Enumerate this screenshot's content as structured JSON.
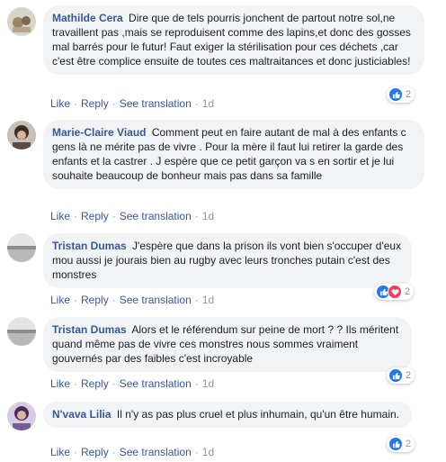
{
  "comments": [
    {
      "author": "Mathilde Cera",
      "text": "Dire que de tels pourris jonchent de partout notre sol,ne travaillent pas ,mais se reproduisent comme des lapins,et donc des gosses mal barrés pour le futur! Faut exiger la stérilisation pour ces déchets ,car c'est être complice ensuite de toutes ces maltraitances et donc justiciables!",
      "like": "Like",
      "reply": "Reply",
      "translate": "See translation",
      "time": "1d",
      "reactions": [
        "like"
      ],
      "reaction_count": "2"
    },
    {
      "author": "Marie-Claire Viaud",
      "text": "Comment peut en faire autant de mal à des enfants c gens là ne mérite pas de vivre . Pour la mère il faut lui retirer la garde des enfants et la castrer . J espère que ce petit garçon va s en sortir et je lui souhaite beaucoup de bonheur mais pas dans sa famille",
      "like": "Like",
      "reply": "Reply",
      "translate": "See translation",
      "time": "1d",
      "reactions": [],
      "reaction_count": ""
    },
    {
      "author": "Tristan Dumas",
      "text": "J'espère que dans la prison ils vont bien s'occuper d'eux mou aussi je jourais bien au rugby avec leurs tronches putain c'est des monstres",
      "like": "Like",
      "reply": "Reply",
      "translate": "See translation",
      "time": "1d",
      "reactions": [
        "like",
        "love"
      ],
      "reaction_count": "2"
    },
    {
      "author": "Tristan Dumas",
      "text": "Alors et le référendum sur peine de mort ? ? Ils méritent quand même pas de vivre ces monstres nous sommes vraiment gouvernés par des faibles c'est incroyable",
      "like": "Like",
      "reply": "Reply",
      "translate": "See translation",
      "time": "1d",
      "reactions": [
        "like"
      ],
      "reaction_count": "2"
    },
    {
      "author": "N'vava Lilia",
      "text": "Il n'y as pas plus cruel et plus inhumain, qu'un être humain.",
      "like": "Like",
      "reply": "Reply",
      "translate": "See translation",
      "time": "1d",
      "reactions": [
        "like"
      ],
      "reaction_count": "2"
    }
  ],
  "colors": {
    "link": "#385898",
    "bubble": "#f2f3f5",
    "like_reaction": "#2078f4",
    "love_reaction": "#f33e58"
  }
}
